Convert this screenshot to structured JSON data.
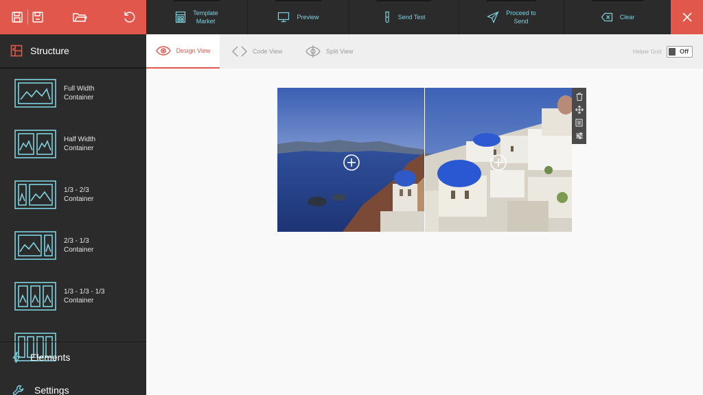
{
  "toolbar": {
    "items": [
      {
        "label": "Template\nMarket",
        "icon": "template-market-icon"
      },
      {
        "label": "Preview",
        "icon": "monitor-icon"
      },
      {
        "label": "Send Test",
        "icon": "test-tube-icon"
      },
      {
        "label": "Proceed to\nSend",
        "icon": "paper-plane-icon"
      },
      {
        "label": "Clear",
        "icon": "clear-backspace-icon"
      }
    ]
  },
  "sidebar": {
    "header": "Structure",
    "items": [
      {
        "label": "Full Width\nContainer"
      },
      {
        "label": "Half Width\nContainer"
      },
      {
        "label": "1/3 - 2/3\nContainer"
      },
      {
        "label": "2/3 - 1/3\nContainer"
      },
      {
        "label": "1/3 - 1/3 - 1/3\nContainer"
      }
    ],
    "elements_label": "Elements",
    "settings_label": "Settings"
  },
  "views": {
    "tabs": [
      {
        "label": "Design View",
        "active": true
      },
      {
        "label": "Code View",
        "active": false
      },
      {
        "label": "Split View",
        "active": false
      }
    ],
    "helper_grid_label": "Helper Grid:",
    "helper_grid_value": "Off"
  },
  "colors": {
    "accent": "#e2574c",
    "toolbar_bg": "#2b2b2c",
    "cyan": "#7fd3e0"
  }
}
